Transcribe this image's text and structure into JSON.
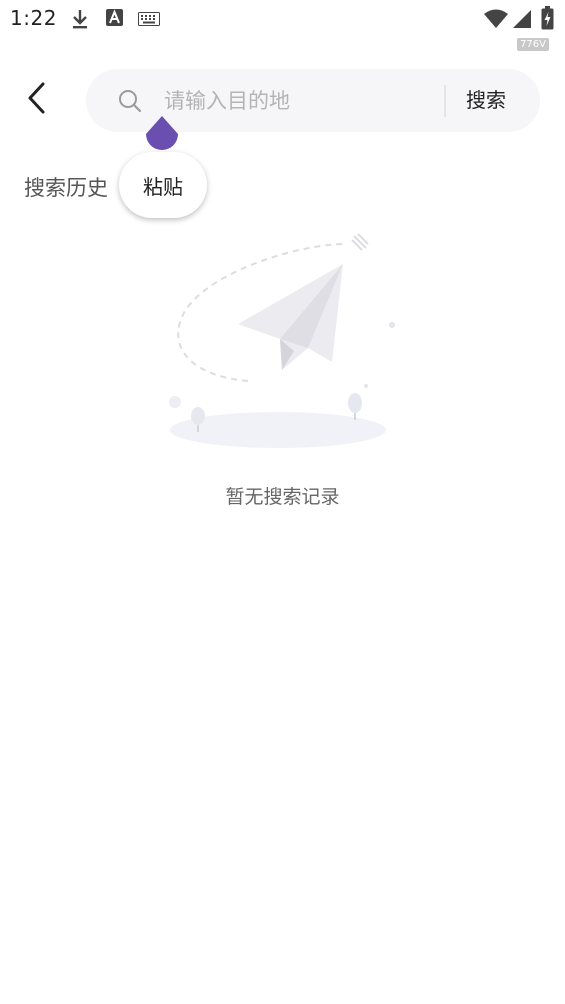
{
  "status_bar": {
    "time": "1:22",
    "speed_badge": "776V",
    "icons": [
      "download-icon",
      "font-a-icon",
      "keyboard-icon",
      "wifi-icon",
      "signal-icon",
      "battery-charging-icon"
    ]
  },
  "header": {
    "back_icon": "chevron-left-icon",
    "search": {
      "placeholder": "请输入目的地",
      "value": "",
      "icon": "search-icon",
      "button_label": "搜索"
    }
  },
  "history": {
    "title": "搜索历史"
  },
  "paste_popup": {
    "label": "粘贴"
  },
  "empty_state": {
    "illustration": "paper-plane-icon",
    "text": "暂无搜索记录"
  },
  "colors": {
    "handle": "#6a4fb0",
    "search_bg": "#f6f6f8",
    "placeholder": "#b4b4b8"
  }
}
